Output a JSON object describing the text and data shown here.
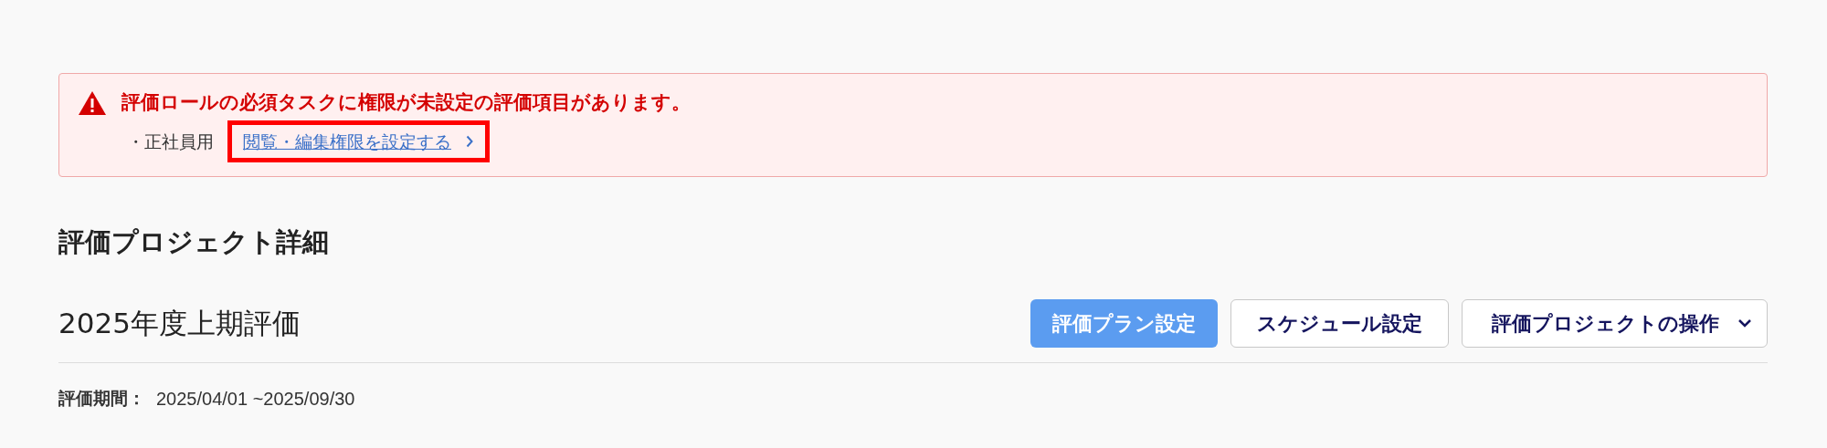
{
  "alert": {
    "title": "評価ロールの必須タスクに権限が未設定の評価項目があります。",
    "items": [
      {
        "bullet": "・",
        "label": "正社員用",
        "link": "閲覧・編集権限を設定する",
        "highlighted": true
      }
    ]
  },
  "page_title": "評価プロジェクト詳細",
  "project": {
    "name": "2025年度上期評価",
    "buttons": [
      {
        "label": "評価プラン設定",
        "kind": "primary"
      },
      {
        "label": "スケジュール設定",
        "kind": "secondary"
      },
      {
        "label": "評価プロジェクトの操作",
        "kind": "dropdown"
      }
    ],
    "period": {
      "label": "評価期間：",
      "value": "2025/04/01 ~2025/09/30"
    }
  }
}
